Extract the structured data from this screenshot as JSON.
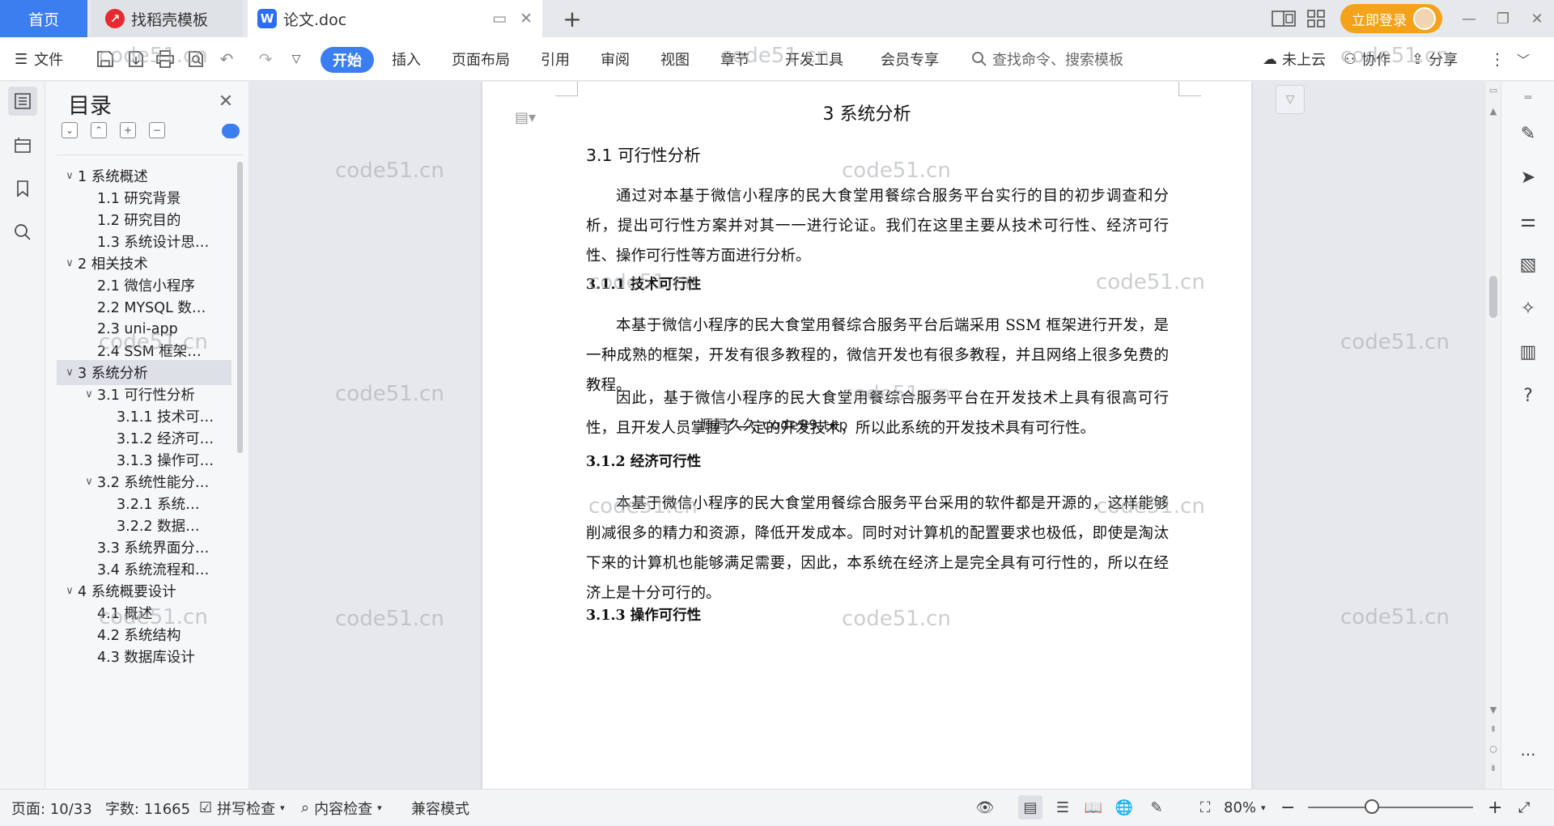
{
  "tabs": {
    "home": "首页",
    "template": "找稻壳模板",
    "document": "论文.doc"
  },
  "titlebar": {
    "login": "立即登录"
  },
  "menu": {
    "file": "文件",
    "items": [
      "开始",
      "插入",
      "页面布局",
      "引用",
      "审阅",
      "视图",
      "章节",
      "开发工具",
      "会员专享"
    ],
    "search_placeholder": "查找命令、搜索模板",
    "cloud": "未上云",
    "collab": "协作",
    "share": "分享"
  },
  "toc": {
    "title": "目录",
    "items": [
      {
        "label": "1 系统概述",
        "level": 1,
        "expanded": true
      },
      {
        "label": "1.1  研究背景",
        "level": 2
      },
      {
        "label": "1.2 研究目的",
        "level": 2
      },
      {
        "label": "1.3 系统设计思…",
        "level": 2
      },
      {
        "label": "2 相关技术",
        "level": 1,
        "expanded": true
      },
      {
        "label": "2.1 微信小程序",
        "level": 2
      },
      {
        "label": "2.2 MYSQL 数…",
        "level": 2
      },
      {
        "label": "2.3 uni-app",
        "level": 2
      },
      {
        "label": "2.4 SSM 框架…",
        "level": 2
      },
      {
        "label": "3 系统分析",
        "level": 1,
        "expanded": true,
        "active": true
      },
      {
        "label": "3.1 可行性分析",
        "level": 2,
        "expanded": true
      },
      {
        "label": "3.1.1 技术可…",
        "level": 3
      },
      {
        "label": "3.1.2 经济可…",
        "level": 3
      },
      {
        "label": "3.1.3 操作可…",
        "level": 3
      },
      {
        "label": "3.2 系统性能分…",
        "level": 2,
        "expanded": true
      },
      {
        "label": "3.2.1  系统…",
        "level": 3
      },
      {
        "label": "3.2.2  数据…",
        "level": 3
      },
      {
        "label": "3.3 系统界面分…",
        "level": 2
      },
      {
        "label": "3.4 系统流程和…",
        "level": 2
      },
      {
        "label": "4 系统概要设计",
        "level": 1,
        "expanded": true
      },
      {
        "label": "4.1 概述",
        "level": 2
      },
      {
        "label": "4.2 系统结构",
        "level": 2
      },
      {
        "label": "4.3 数据库设计",
        "level": 2
      }
    ]
  },
  "document": {
    "chapter": "3 系统分析",
    "section_31": "3.1 可行性分析",
    "p_intro": "通过对本基于微信小程序的民大食堂用餐综合服务平台实行的目的初步调查和分析，提出可行性方案并对其一一进行论证。我们在这里主要从技术可行性、经济可行性、操作可行性等方面进行分析。",
    "section_311": "3.1.1 技术可行性",
    "p_tech1": "本基于微信小程序的民大食堂用餐综合服务平台后端采用 SSM 框架进行开发，是一种成熟的框架，开发有很多教程的，微信开发也有很多教程，并且网络上很多免费的教程。",
    "p_tech2": "因此，基于微信小程序的民大食堂用餐综合服务平台在开发技术上具有很高可行性，且开发人员掌握了一定的开发技术，所以此系统的开发技术具有可行性。",
    "section_312": "3.1.2 经济可行性",
    "p_econ": "本基于微信小程序的民大食堂用餐综合服务平台采用的软件都是开源的，这样能够削减很多的精力和资源，降低开发成本。同时对计算机的配置要求也极低，即使是淘汰下来的计算机也能够满足需要，因此，本系统在经济上是完全具有可行性的，所以在经济上是十分可行的。",
    "section_313": "3.1.3 操作可行性",
    "overlay": "源码久久 code99.top"
  },
  "watermark": "code51.cn",
  "status": {
    "page": "页面: 10/33",
    "words": "字数: 11665",
    "spell": "拼写检查",
    "content_check": "内容检查",
    "compat": "兼容模式",
    "zoom": "80%"
  }
}
